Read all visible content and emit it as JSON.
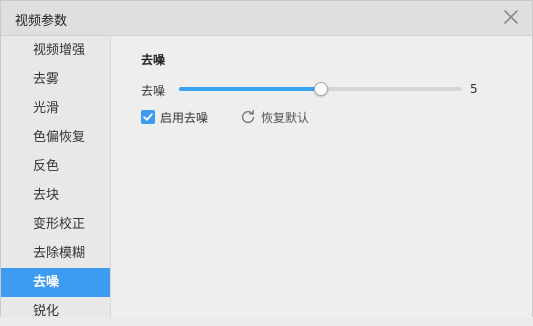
{
  "window": {
    "title": "视频参数",
    "close_icon": "close-icon"
  },
  "sidebar": {
    "items": [
      {
        "label": "视频增强",
        "active": false
      },
      {
        "label": "去雾",
        "active": false
      },
      {
        "label": "光滑",
        "active": false
      },
      {
        "label": "色偏恢复",
        "active": false
      },
      {
        "label": "反色",
        "active": false
      },
      {
        "label": "去块",
        "active": false
      },
      {
        "label": "变形校正",
        "active": false
      },
      {
        "label": "去除模糊",
        "active": false
      },
      {
        "label": "去噪",
        "active": true
      },
      {
        "label": "锐化",
        "active": false
      }
    ]
  },
  "panel": {
    "section_title": "去噪",
    "slider": {
      "label": "去噪",
      "value": 5,
      "value_text": "5",
      "fraction": 0.5
    },
    "checkbox": {
      "label": "启用去噪",
      "checked": true
    },
    "reset": {
      "label": "恢复默认",
      "icon": "refresh-icon"
    }
  },
  "colors": {
    "accent": "#3d9bf2",
    "slider_fill": "#36a3f6",
    "track": "#d6d6d6"
  }
}
